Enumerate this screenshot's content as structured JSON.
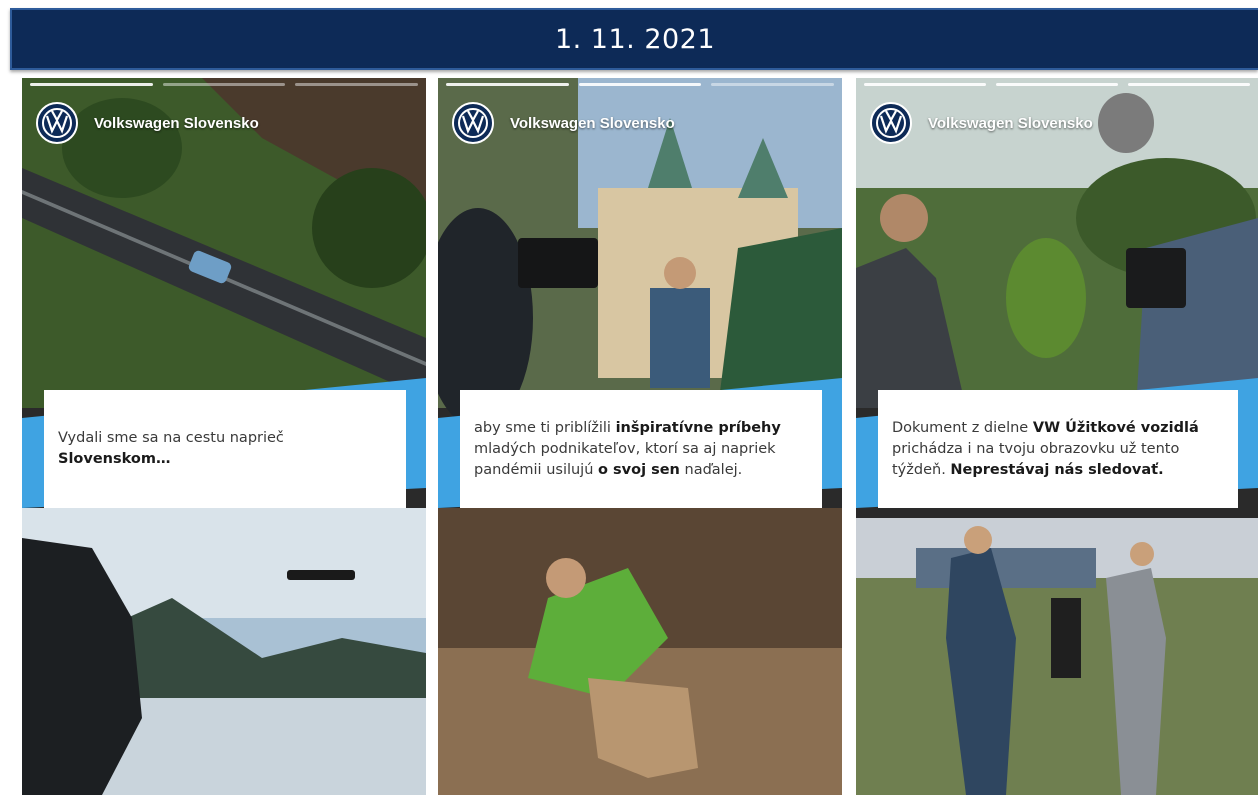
{
  "header": {
    "date": "1. 11. 2021"
  },
  "colors": {
    "brand_navy": "#0d2a57",
    "band_blue": "#3fa3e2"
  },
  "stories": [
    {
      "account": "Volkswagen Slovensko",
      "caption_parts": [
        {
          "text": "Vydali sme sa na cestu naprieč ",
          "bold": false
        },
        {
          "text": "Slovenskom…",
          "bold": true
        }
      ]
    },
    {
      "account": "Volkswagen Slovensko",
      "caption_parts": [
        {
          "text": "aby sme ti priblížili ",
          "bold": false
        },
        {
          "text": "inšpiratívne príbehy",
          "bold": true
        },
        {
          "text": " mladých podnikateľov, ktorí sa aj napriek pandémii usilujú ",
          "bold": false
        },
        {
          "text": "o svoj sen",
          "bold": true
        },
        {
          "text": " naďalej.",
          "bold": false
        }
      ]
    },
    {
      "account": "Volkswagen Slovensko",
      "caption_parts": [
        {
          "text": "Dokument z dielne ",
          "bold": false
        },
        {
          "text": "VW Úžitkové vozidlá",
          "bold": true
        },
        {
          "text": " prichádza i na tvoju obrazovku už tento týždeň. ",
          "bold": false
        },
        {
          "text": "Neprestávaj nás sledovať.",
          "bold": true
        }
      ]
    }
  ]
}
